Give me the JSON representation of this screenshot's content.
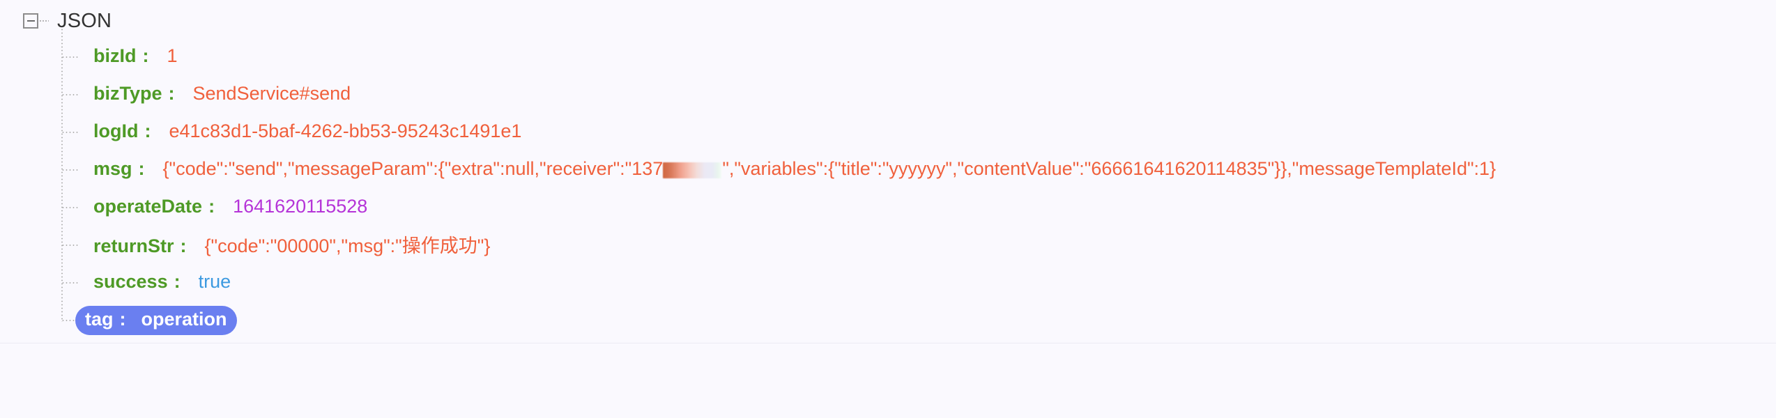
{
  "viewer": {
    "root_label": "JSON",
    "toggle_icon": "collapse-minus-icon",
    "background_color": "#faf9fe",
    "key_color": "#4e9a26",
    "string_value_color": "#f0603c",
    "number_value_color": "#b534d8",
    "boolean_value_color": "#3d9ae0",
    "selection_color": "#6a7ff0"
  },
  "entries": [
    {
      "key": "bizId",
      "colon": ":",
      "value": "1",
      "type": "number-orange",
      "selected": false
    },
    {
      "key": "bizType",
      "colon": ":",
      "value": "SendService#send",
      "type": "string",
      "selected": false
    },
    {
      "key": "logId",
      "colon": ":",
      "value": "e41c83d1-5baf-4262-bb53-95243c1491e1",
      "type": "string",
      "selected": false
    },
    {
      "key": "msg",
      "colon": ":",
      "value_before_redaction": "{\"code\":\"send\",\"messageParam\":{\"extra\":null,\"receiver\":\"137",
      "redacted": "redacted-phone-number",
      "value_after_redaction": "\",\"variables\":{\"title\":\"yyyyyy\",\"contentValue\":\"66661641620114835\"}},\"messageTemplateId\":1}",
      "type": "string",
      "selected": false
    },
    {
      "key": "operateDate",
      "colon": ":",
      "value": "1641620115528",
      "type": "number",
      "selected": false
    },
    {
      "key": "returnStr",
      "colon": ":",
      "value": "{\"code\":\"00000\",\"msg\":\"操作成功\"}",
      "type": "string",
      "selected": false
    },
    {
      "key": "success",
      "colon": ":",
      "value": "true",
      "type": "boolean",
      "selected": false
    },
    {
      "key": "tag",
      "colon": ":",
      "value": "operation",
      "type": "string",
      "selected": true
    }
  ]
}
